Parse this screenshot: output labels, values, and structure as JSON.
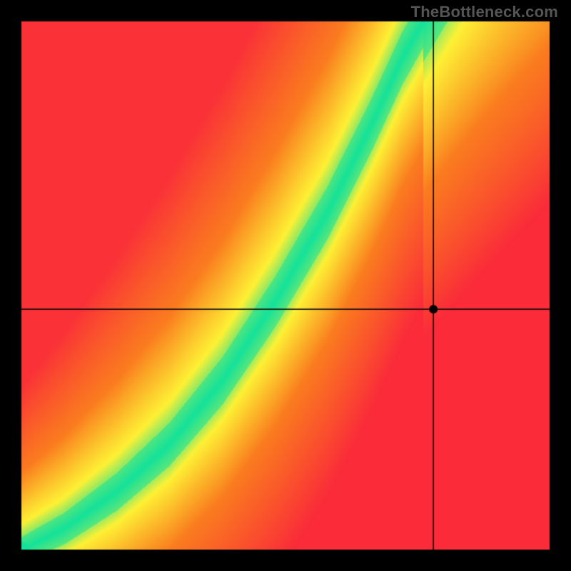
{
  "watermark": "TheBottleneck.com",
  "chart_data": {
    "type": "heatmap",
    "title": "",
    "xlabel": "",
    "ylabel": "",
    "grid": false,
    "legend": false,
    "border_px": 30,
    "crosshair": {
      "x_frac": 0.78,
      "y_frac": 0.455,
      "marker_radius_px": 6
    },
    "ridge": {
      "description": "Green optimum band follows a monotonically increasing curve from bottom-left to upper-middle; away from it, color falls through yellow/orange to red. Upper-right corner shows a secondary yellow wash.",
      "control_points_frac": [
        [
          0.0,
          0.0
        ],
        [
          0.08,
          0.04
        ],
        [
          0.18,
          0.11
        ],
        [
          0.28,
          0.2
        ],
        [
          0.38,
          0.32
        ],
        [
          0.48,
          0.47
        ],
        [
          0.58,
          0.64
        ],
        [
          0.66,
          0.8
        ],
        [
          0.72,
          0.93
        ],
        [
          0.76,
          1.0
        ]
      ],
      "approx_width_frac": 0.055
    },
    "axes": {
      "xrange_frac": [
        0,
        1
      ],
      "yrange_frac": [
        0,
        1
      ]
    },
    "colors": {
      "green": "#14e29a",
      "yellow": "#fef135",
      "orange": "#fa7d1f",
      "red": "#fb2b3a",
      "border": "#000000"
    }
  }
}
